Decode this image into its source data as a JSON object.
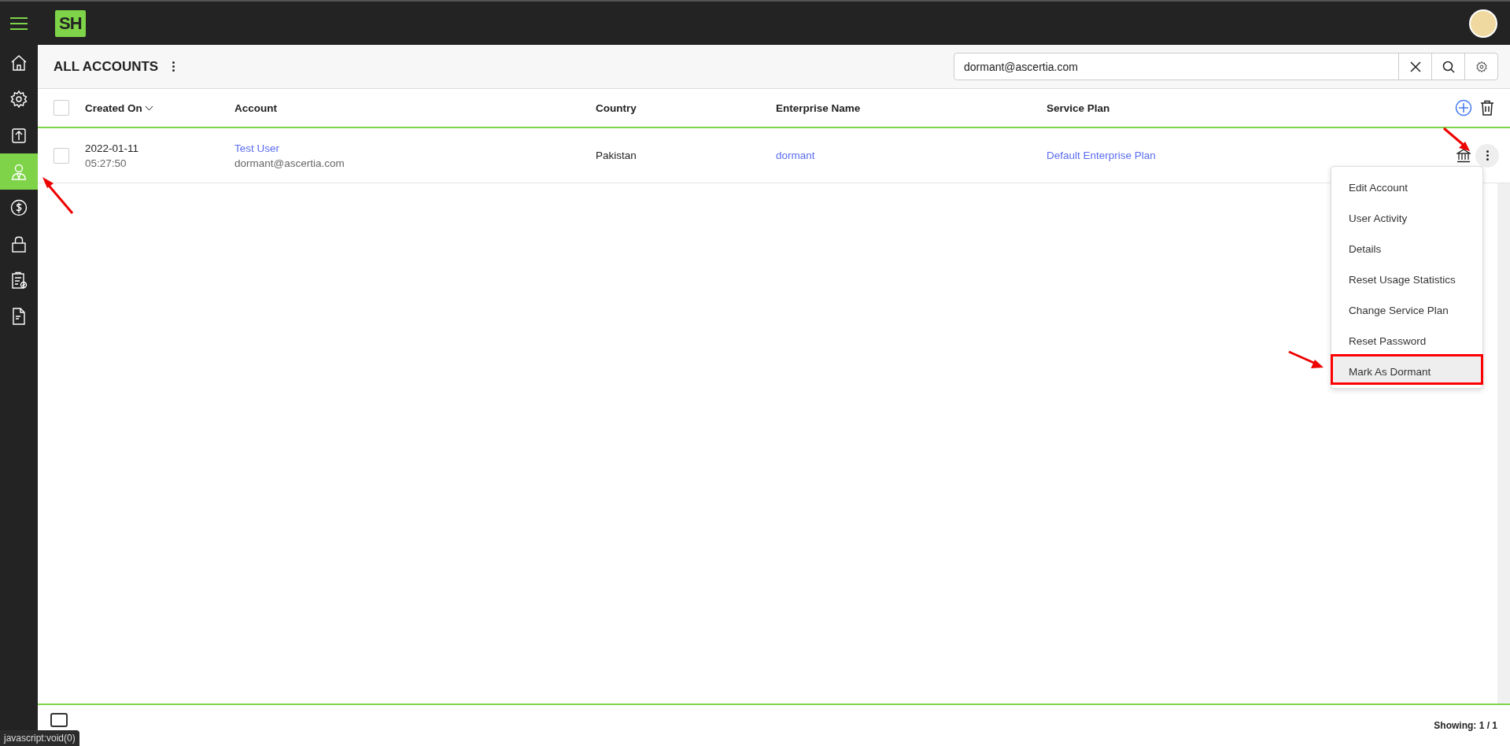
{
  "logo": {
    "text": "SH"
  },
  "sidebar": {
    "items": [
      {
        "kind": "home",
        "selected": false
      },
      {
        "kind": "gear",
        "selected": false
      },
      {
        "kind": "upload",
        "selected": false
      },
      {
        "kind": "user",
        "selected": true
      },
      {
        "kind": "dollar",
        "selected": false
      },
      {
        "kind": "lock",
        "selected": false
      },
      {
        "kind": "clipboard",
        "selected": false
      },
      {
        "kind": "document",
        "selected": false
      }
    ]
  },
  "page": {
    "title": "ALL ACCOUNTS"
  },
  "search": {
    "value": "dormant@ascertia.com"
  },
  "table": {
    "select_all_checked": false,
    "columns": [
      "Created On",
      "Account",
      "Country",
      "Enterprise Name",
      "Service Plan"
    ],
    "rows": [
      {
        "checked": false,
        "date": "2022-01-11",
        "time": "05:27:50",
        "account_name": "Test User",
        "account_email": "dormant@ascertia.com",
        "country": "Pakistan",
        "enterprise": "dormant",
        "service_plan": "Default Enterprise Plan"
      }
    ]
  },
  "menu": {
    "items": [
      {
        "label": "Edit Account",
        "selected": false
      },
      {
        "label": "User Activity",
        "selected": false
      },
      {
        "label": "Details",
        "selected": false
      },
      {
        "label": "Reset Usage Statistics",
        "selected": false
      },
      {
        "label": "Change Service Plan",
        "selected": false
      },
      {
        "label": "Reset Password",
        "selected": false
      },
      {
        "label": "Mark As Dormant",
        "selected": true
      }
    ]
  },
  "footer": {
    "showing": "Showing: 1 / 1"
  },
  "status_bar": {
    "text": "javascript:void(0)"
  }
}
